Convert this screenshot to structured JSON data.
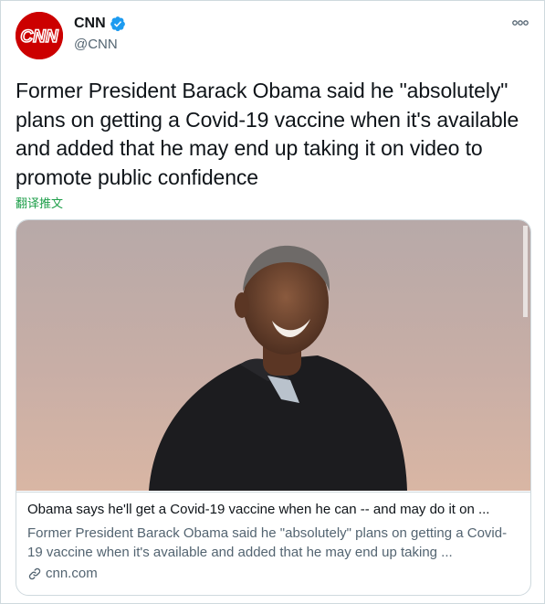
{
  "tweet": {
    "author": {
      "display_name": "CNN",
      "handle": "@CNN",
      "avatar_text": "CNN",
      "verified": true,
      "avatar_color": "#cc0000"
    },
    "more_icon": "ellipsis-icon",
    "text": "Former President Barack Obama said he \"absolutely\" plans on getting a Covid-19 vaccine when it's available and added that he may end up taking it on video to promote public confidence",
    "translate_label": "翻译推文"
  },
  "card": {
    "title": "Obama says he'll get a Covid-19 vaccine when he can -- and may do it on ...",
    "description": "Former President Barack Obama said he \"absolutely\" plans on getting a Covid-19 vaccine when it's available and added that he may end up taking ...",
    "domain": "cnn.com",
    "domain_icon": "link-icon"
  },
  "colors": {
    "accent_blue": "#1d9bf0",
    "translate_green": "#1d9e49",
    "secondary_text": "#536471"
  }
}
